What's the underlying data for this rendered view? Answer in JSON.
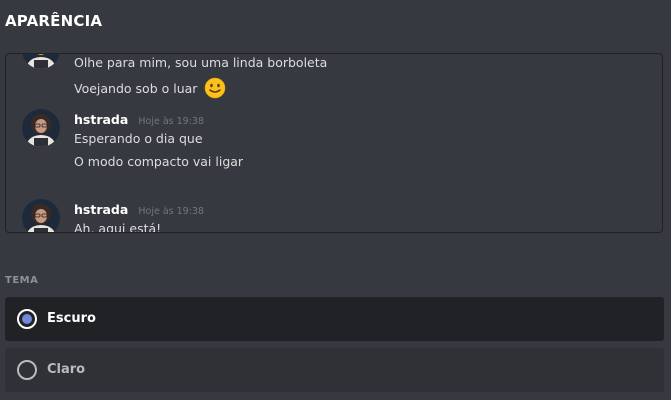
{
  "header": {
    "title": "APARÊNCIA"
  },
  "preview": {
    "messages": [
      {
        "username": "",
        "timestamp": "",
        "lines": [
          "Olhe para mim, sou uma linda borboleta",
          "Voejando sob o luar"
        ],
        "emoji": "slightly-smiling-face-emoji"
      },
      {
        "username": "hstrada",
        "timestamp": "Hoje às 19:38",
        "lines": [
          "Esperando o dia que",
          "O modo compacto vai ligar"
        ]
      },
      {
        "username": "hstrada",
        "timestamp": "Hoje às 19:38",
        "lines": [
          "Ah, aqui está!"
        ]
      }
    ]
  },
  "theme": {
    "label": "TEMA",
    "options": [
      {
        "label": "Escuro",
        "selected": true
      },
      {
        "label": "Claro",
        "selected": false
      }
    ]
  },
  "colors": {
    "background": "#36393f",
    "selected_option_bg": "#202225",
    "option_bg": "#2f3136",
    "accent": "#7289da",
    "timestamp": "#72767d"
  }
}
